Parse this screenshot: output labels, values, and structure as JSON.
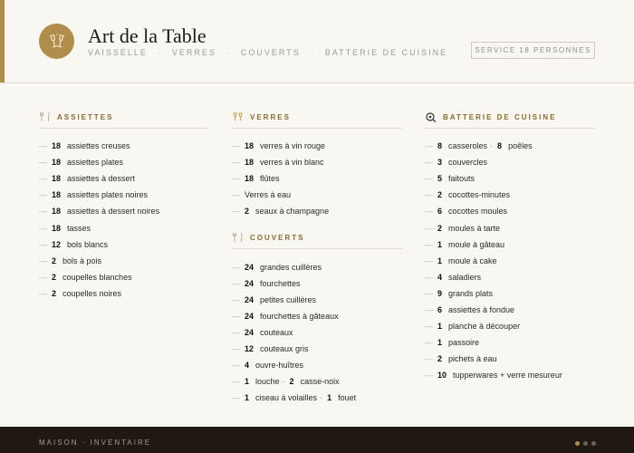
{
  "header": {
    "title": "Art de la Table",
    "nav": [
      "VAISSELLE",
      "VERRES",
      "COUVERTS",
      "BATTERIE DE CUISINE"
    ],
    "nav_separator": "·",
    "service_label": "SERVICE 18 PERSONNES"
  },
  "colors": {
    "accent": "#b08d4a",
    "background": "#f9f7f2",
    "footer": "#211812"
  },
  "sections": {
    "assiettes": {
      "title": "ASSIETTES",
      "icon": "fork-knife-icon",
      "items": [
        {
          "qty": "18",
          "label": "assiettes creuses"
        },
        {
          "qty": "18",
          "label": "assiettes plates"
        },
        {
          "qty": "18",
          "label": "assiettes à dessert"
        },
        {
          "qty": "18",
          "label": "assiettes plates noires"
        },
        {
          "qty": "18",
          "label": "assiettes à dessert noires"
        },
        {
          "qty": "18",
          "label": "tasses"
        },
        {
          "qty": "12",
          "label": "bols blancs"
        },
        {
          "qty": "2",
          "label": "bols à pois"
        },
        {
          "qty": "2",
          "label": "coupelles blanches"
        },
        {
          "qty": "2",
          "label": "coupelles noires"
        }
      ]
    },
    "verres": {
      "title": "VERRES",
      "icon": "champagne-glasses-icon",
      "items": [
        {
          "qty": "18",
          "label": "verres à vin rouge"
        },
        {
          "qty": "18",
          "label": "verres à vin blanc"
        },
        {
          "qty": "18",
          "label": "flûtes"
        },
        {
          "qty": "",
          "label": "Verres à eau"
        },
        {
          "qty": "2",
          "label": "seaux à champagne"
        }
      ]
    },
    "couverts": {
      "title": "COUVERTS",
      "icon": "fork-knife-icon",
      "items": [
        {
          "qty": "24",
          "label": "grandes cuillères"
        },
        {
          "qty": "24",
          "label": "fourchettes"
        },
        {
          "qty": "24",
          "label": "petites cuillères"
        },
        {
          "qty": "24",
          "label": "fourchettes à gâteaux"
        },
        {
          "qty": "24",
          "label": "couteaux"
        },
        {
          "qty": "12",
          "label": "couteaux gris"
        },
        {
          "qty": "4",
          "label": "ouvre-huîtres"
        },
        {
          "qty": "1",
          "label": "louche",
          "qty2": "2",
          "label2": "casse-noix"
        },
        {
          "qty": "1",
          "label": "ciseau à volailles",
          "qty2": "1",
          "label2": "fouet"
        }
      ]
    },
    "batterie": {
      "title": "BATTERIE DE CUISINE",
      "icon": "pot-icon",
      "items": [
        {
          "qty": "8",
          "label": "casseroles",
          "qty2": "8",
          "label2": "poêles"
        },
        {
          "qty": "3",
          "label": "couvercles"
        },
        {
          "qty": "5",
          "label": "faitouts"
        },
        {
          "qty": "2",
          "label": "cocottes-minutes"
        },
        {
          "qty": "6",
          "label": "cocottes moules"
        },
        {
          "qty": "2",
          "label": "moules à tarte"
        },
        {
          "qty": "1",
          "label": "moule à gâteau"
        },
        {
          "qty": "1",
          "label": "moule à cake"
        },
        {
          "qty": "4",
          "label": "saladiers"
        },
        {
          "qty": "9",
          "label": "grands plats"
        },
        {
          "qty": "6",
          "label": "assiettes à fondue"
        },
        {
          "qty": "1",
          "label": "planche à découper"
        },
        {
          "qty": "1",
          "label": "passoire"
        },
        {
          "qty": "2",
          "label": "pichets à eau"
        },
        {
          "qty": "10",
          "label": "tupperwares + verre mesureur"
        }
      ]
    }
  },
  "footer": {
    "text": "MAISON · INVENTAIRE",
    "page_dots": 3,
    "active_dot": 0
  }
}
